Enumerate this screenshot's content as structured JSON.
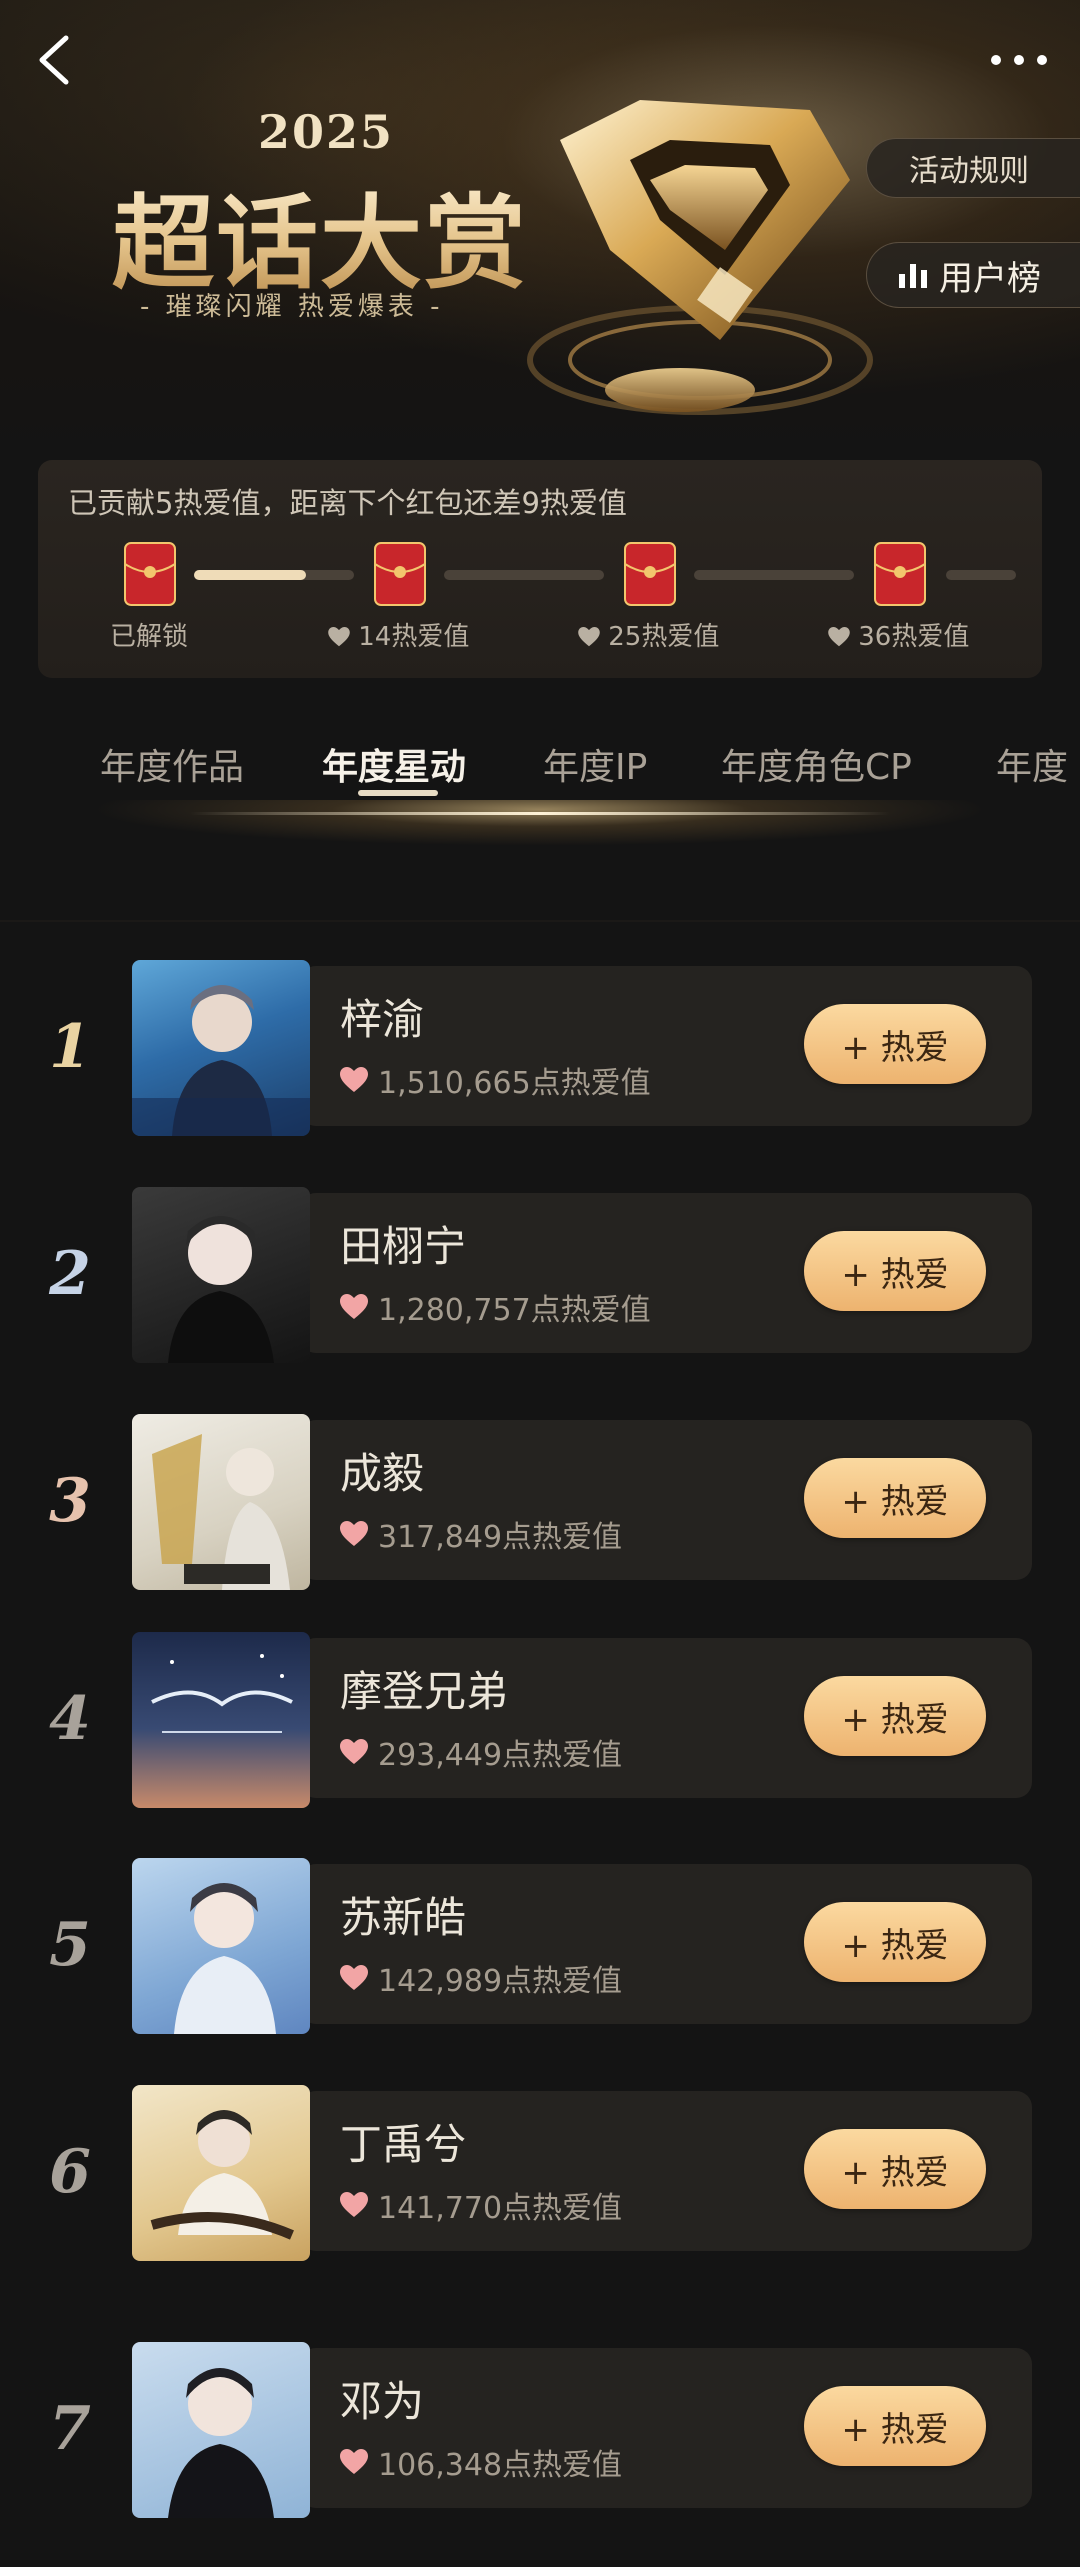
{
  "header": {
    "year": "2025",
    "title": "超话大赏",
    "slogan": "- 璀璨闪耀 热爱爆表 -",
    "rules_label": "活动规则",
    "users_label": "用户榜"
  },
  "progress": {
    "text": "已贡献5热爱值，距离下个红包还差9热爱值",
    "milestones": [
      {
        "label": "已解锁",
        "unlocked": true
      },
      {
        "label": "14热爱值",
        "unlocked": false
      },
      {
        "label": "25热爱值",
        "unlocked": false
      },
      {
        "label": "36热爱值",
        "unlocked": false
      }
    ],
    "first_segment_fill": 0.7
  },
  "tabs": [
    {
      "label": "年度作品",
      "active": false
    },
    {
      "label": "年度星动",
      "active": true
    },
    {
      "label": "年度IP",
      "active": false
    },
    {
      "label": "年度角色CP",
      "active": false
    },
    {
      "label": "年度",
      "active": false
    }
  ],
  "ranking": [
    {
      "rank": "1",
      "name": "梓渝",
      "score": "1,510,665点热爱值",
      "button": "+ 热爱",
      "rank_color": "#e9d3a2"
    },
    {
      "rank": "2",
      "name": "田栩宁",
      "score": "1,280,757点热爱值",
      "button": "+ 热爱",
      "rank_color": "#c6d3e6"
    },
    {
      "rank": "3",
      "name": "成毅",
      "score": "317,849点热爱值",
      "button": "+ 热爱",
      "rank_color": "#e6c2ad"
    },
    {
      "rank": "4",
      "name": "摩登兄弟",
      "score": "293,449点热爱值",
      "button": "+ 热爱",
      "rank_color": "#a8a29a"
    },
    {
      "rank": "5",
      "name": "苏新皓",
      "score": "142,989点热爱值",
      "button": "+ 热爱",
      "rank_color": "#a8a29a"
    },
    {
      "rank": "6",
      "name": "丁禹兮",
      "score": "141,770点热爱值",
      "button": "+ 热爱",
      "rank_color": "#a8a29a"
    },
    {
      "rank": "7",
      "name": "邓为",
      "score": "106,348点热爱值",
      "button": "+ 热爱",
      "rank_color": "#a8a29a"
    }
  ],
  "colors": {
    "background": "#141414",
    "accent_gold": "#edb36f",
    "heart": "#f2a5a5",
    "red_packet": "#c8262b"
  }
}
